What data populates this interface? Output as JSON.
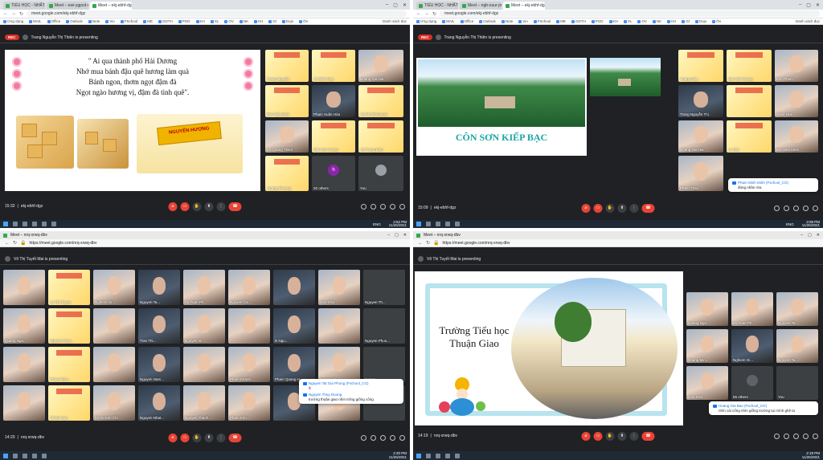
{
  "q1": {
    "tabs": [
      "TIỂU HỌC - NHẤT KÍ CHỦ NHIỆM",
      "Meet – ewi-ygpcd-qpa",
      "Meet – ekj-ebhf-dgz"
    ],
    "url": "meet.google.com/ekj-ebhf-dgz",
    "bookmarks": [
      "Ứng dụng",
      "MAIL",
      "Office",
      "Outlook",
      "Note",
      "Vio",
      "FSchool",
      "ME",
      "GDTH",
      "PGD",
      "KH",
      "XL",
      "OV",
      "NK",
      "KH",
      "Gl",
      "Dojo",
      "Ôn"
    ],
    "bookmarks_right": "Danh sách đọc",
    "presenter": "Trang Nguyễn Thị Thiên is presenting",
    "rec": "REC",
    "poem": [
      "\" Ai qua thành phố Hải Dương",
      "Nhớ mua bánh đậu quê hương làm quà",
      "Bánh ngon, thơm ngọt đậm đà",
      "Ngọt ngào hương vị, đậm đà tình quê\"."
    ],
    "box_label": "NGUYÊN HƯƠNG",
    "tiles": [
      "Trang Nguyễn",
      "Lê Minh Duy",
      "Hoàng Gia Hải",
      "Bùi Hiếu Minh",
      "Phạm Xuân Hòa",
      "Hà Phi (Fschool)",
      "Le Quang Thien",
      "Mai Viet Hoang",
      "Hà Trung Kiên",
      "Hoang Phuong",
      "20 others",
      "You"
    ],
    "others_letter": "h",
    "time": "15:32",
    "meet_id": "ekj-ebhf-dgz",
    "clock_time": "3:52 PM",
    "clock_date": "11/26/2021",
    "lang": "ENG"
  },
  "q2": {
    "tabs": [
      "TIỂU HỌC - NHẤT KÍ CHỦ NHIỆM",
      "Meet – ngb-ouur-jmr",
      "Meet – ekj-ebhf-dgz"
    ],
    "url": "meet.google.com/ekj-ebhf-dgz",
    "bookmarks": [
      "Ứng dụng",
      "MAIL",
      "Office",
      "Outlook",
      "Note",
      "Vio",
      "FSchool",
      "ME",
      "GDTH",
      "PGD",
      "KH",
      "XL",
      "OV",
      "NK",
      "KH",
      "Gl",
      "Dojo",
      "Ôn"
    ],
    "bookmarks_right": "Danh sách đọc",
    "presenter": "Trang Nguyễn Thị Thiên is presenting",
    "rec": "REC",
    "slide_title": "CÔN SƠN KIẾP BẠC",
    "tiles": [
      "Hoang Gia...",
      "Mai Viet Hoang",
      "Kim Pham",
      "Trang Nguyễn Thị",
      "",
      "Xuan Hoa",
      "Hoang Gia Hai",
      "Le Mai",
      "Bui Hieu Minh",
      "Pham Thao",
      "",
      ""
    ],
    "chat_name": "Pham Minh Minh (Fschool_CG)",
    "chat_msg": "đúng nhân rửa",
    "time": "15:09",
    "meet_id": "ekj-ebhf-dgz",
    "clock_time": "3:09 PM",
    "clock_date": "11/26/2021",
    "lang": "ENG"
  },
  "q3": {
    "tabs": [
      "Meet – nrq-xrwq-dbv"
    ],
    "url": "https://meet.google.com/nrq-xrwq-dbv",
    "presenter": "Võ Thị Tuyết Mai is presenting",
    "tiles": [
      "",
      "Vo Thi Tuyen",
      "Nghiem Gi...",
      "Nguyen Ta...",
      "Vu Tuan Ph...",
      "Nguyen Ca...",
      "",
      "Cao Khoi",
      "Nguyen Th...",
      "Quang Ngo...",
      "Nguyen Cam...",
      "",
      "Tran Thi...",
      "Nguyen Gi...",
      "",
      "N Ngu...",
      "",
      "Nguyen Phuo...",
      "",
      "Pham Nam...",
      "",
      "Nguyen Nam...",
      "",
      "Pham Khanh...",
      "Pham Quang H...",
      "Hoang Vn...",
      "Hoang...",
      "",
      "32 Bui Van...",
      "04 Vu Kim Chi",
      "Nguyen Nhat...",
      "Nguyen Thanh...",
      "Pham Kim...",
      "",
      "",
      "",
      "Nguyen..."
    ],
    "chat": [
      {
        "name": "Nguyen Tat Gia Phong (Fschool_CG)",
        "msg": "ữ"
      },
      {
        "name": "Nguyen Thuy Duong",
        "msg": "trường thuận giao nhìn trông giống cổng"
      }
    ],
    "time": "14:20",
    "meet_id": "nrq-xrwq-dbv",
    "clock_time": "2:20 PM",
    "clock_date": "11/26/2021"
  },
  "q4": {
    "tabs": [
      "Meet – nrq-xrwq-dbv"
    ],
    "url": "https://meet.google.com/nrq-xrwq-dbv",
    "presenter": "Võ Thị Tuyết Mai is presenting",
    "slide_title": [
      "Trường Tiểu học",
      "Thuận Giao"
    ],
    "tiles": [
      "Quang Ngo...",
      "Vu Tuan Ph...",
      "Nguyen Ta...",
      "Hoang Min...",
      "Nghiem Gi...",
      "Nguyen Ta...",
      "Cao Khoi",
      "55 others",
      "You"
    ],
    "chat_name": "Hoang Gia Bao (Fschool_CG)",
    "chat_msg": "nhìn cái cổng nhìn giống trường tụi mình ghê ta",
    "time": "14:19",
    "meet_id": "nrq-xrwq-dbv",
    "clock_time": "2:19 PM",
    "clock_date": "11/26/2021"
  },
  "colors": {
    "meet_bg": "#202124",
    "end_call": "#ea4335",
    "accent": "#1a73e8",
    "rec": "#d93025"
  }
}
